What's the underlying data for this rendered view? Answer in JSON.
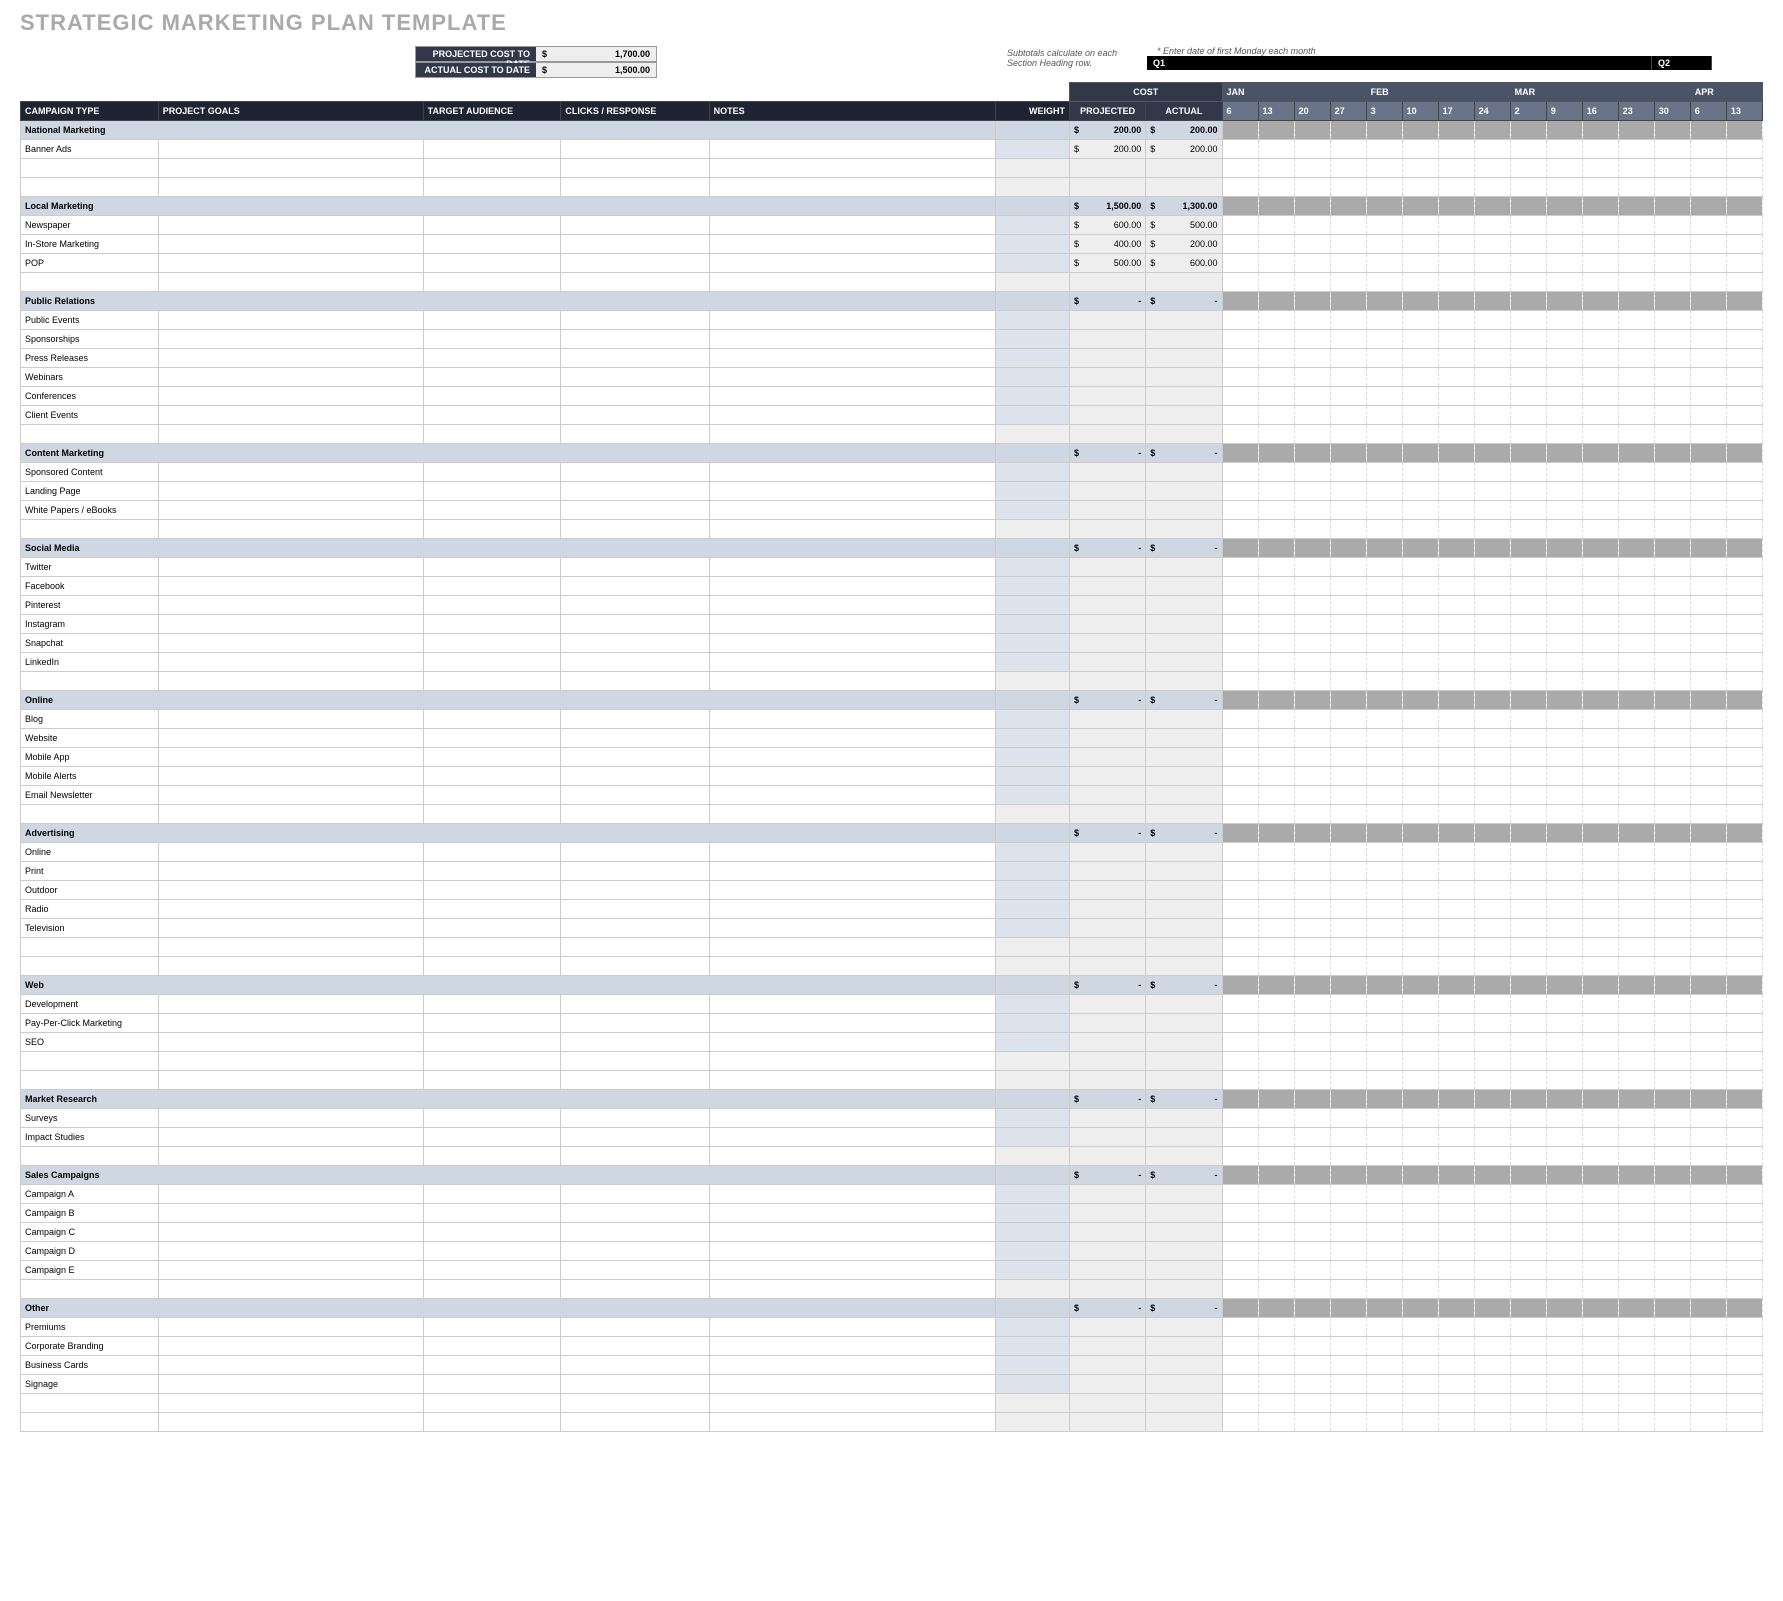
{
  "title": "STRATEGIC MARKETING PLAN TEMPLATE",
  "summary": {
    "projected_label": "PROJECTED COST TO DATE",
    "projected_value": "1,700.00",
    "actual_label": "ACTUAL COST TO DATE",
    "actual_value": "1,500.00"
  },
  "notes": {
    "subtotals": "Subtotals calculate on each Section Heading row.",
    "enter_date": "* Enter date of first Monday each month"
  },
  "quarters": {
    "q1": "Q1",
    "q2": "Q2"
  },
  "cost_header": "COST",
  "columns": {
    "type": "CAMPAIGN TYPE",
    "goals": "PROJECT GOALS",
    "aud": "TARGET AUDIENCE",
    "clicks": "CLICKS / RESPONSE",
    "notes": "NOTES",
    "weight": "WEIGHT",
    "proj": "PROJECTED",
    "act": "ACTUAL"
  },
  "months": [
    "JAN",
    "FEB",
    "MAR",
    "APR"
  ],
  "days": [
    "6",
    "13",
    "20",
    "27",
    "3",
    "10",
    "17",
    "24",
    "2",
    "9",
    "16",
    "23",
    "30",
    "6",
    "13"
  ],
  "sections": [
    {
      "name": "National Marketing",
      "proj": "200.00",
      "act": "200.00",
      "rows": [
        {
          "name": "Banner Ads",
          "proj": "200.00",
          "act": "200.00"
        },
        {
          "blank": true
        },
        {
          "blank": true
        }
      ]
    },
    {
      "name": "Local Marketing",
      "proj": "1,500.00",
      "act": "1,300.00",
      "rows": [
        {
          "name": "Newspaper",
          "proj": "600.00",
          "act": "500.00"
        },
        {
          "name": "In-Store Marketing",
          "proj": "400.00",
          "act": "200.00"
        },
        {
          "name": "POP",
          "proj": "500.00",
          "act": "600.00"
        },
        {
          "blank": true
        }
      ]
    },
    {
      "name": "Public Relations",
      "proj": "-",
      "act": "-",
      "rows": [
        {
          "name": "Public Events"
        },
        {
          "name": "Sponsorships"
        },
        {
          "name": "Press Releases"
        },
        {
          "name": "Webinars"
        },
        {
          "name": "Conferences"
        },
        {
          "name": "Client Events"
        },
        {
          "blank": true
        }
      ]
    },
    {
      "name": "Content Marketing",
      "proj": "-",
      "act": "-",
      "rows": [
        {
          "name": "Sponsored Content"
        },
        {
          "name": "Landing Page"
        },
        {
          "name": "White Papers / eBooks"
        },
        {
          "blank": true
        }
      ]
    },
    {
      "name": "Social Media",
      "proj": "-",
      "act": "-",
      "rows": [
        {
          "name": "Twitter"
        },
        {
          "name": "Facebook"
        },
        {
          "name": "Pinterest"
        },
        {
          "name": "Instagram"
        },
        {
          "name": "Snapchat"
        },
        {
          "name": "LinkedIn"
        },
        {
          "blank": true
        }
      ]
    },
    {
      "name": "Online",
      "proj": "-",
      "act": "-",
      "rows": [
        {
          "name": "Blog"
        },
        {
          "name": "Website"
        },
        {
          "name": "Mobile App"
        },
        {
          "name": "Mobile Alerts"
        },
        {
          "name": "Email Newsletter"
        },
        {
          "blank": true
        }
      ]
    },
    {
      "name": "Advertising",
      "proj": "-",
      "act": "-",
      "rows": [
        {
          "name": "Online"
        },
        {
          "name": "Print"
        },
        {
          "name": "Outdoor"
        },
        {
          "name": "Radio"
        },
        {
          "name": "Television"
        },
        {
          "blank": true
        },
        {
          "blank": true
        }
      ]
    },
    {
      "name": "Web",
      "proj": "-",
      "act": "-",
      "rows": [
        {
          "name": "Development"
        },
        {
          "name": "Pay-Per-Click Marketing"
        },
        {
          "name": "SEO"
        },
        {
          "blank": true
        },
        {
          "blank": true
        }
      ]
    },
    {
      "name": "Market Research",
      "proj": "-",
      "act": "-",
      "rows": [
        {
          "name": "Surveys"
        },
        {
          "name": "Impact Studies"
        },
        {
          "blank": true
        }
      ]
    },
    {
      "name": "Sales Campaigns",
      "proj": "-",
      "act": "-",
      "rows": [
        {
          "name": "Campaign A"
        },
        {
          "name": "Campaign B"
        },
        {
          "name": "Campaign C"
        },
        {
          "name": "Campaign D"
        },
        {
          "name": "Campaign E"
        },
        {
          "blank": true
        }
      ]
    },
    {
      "name": "Other",
      "proj": "-",
      "act": "-",
      "rows": [
        {
          "name": "Premiums"
        },
        {
          "name": "Corporate Branding"
        },
        {
          "name": "Business Cards"
        },
        {
          "name": "Signage"
        },
        {
          "blank": true
        },
        {
          "blank": true
        }
      ]
    }
  ]
}
